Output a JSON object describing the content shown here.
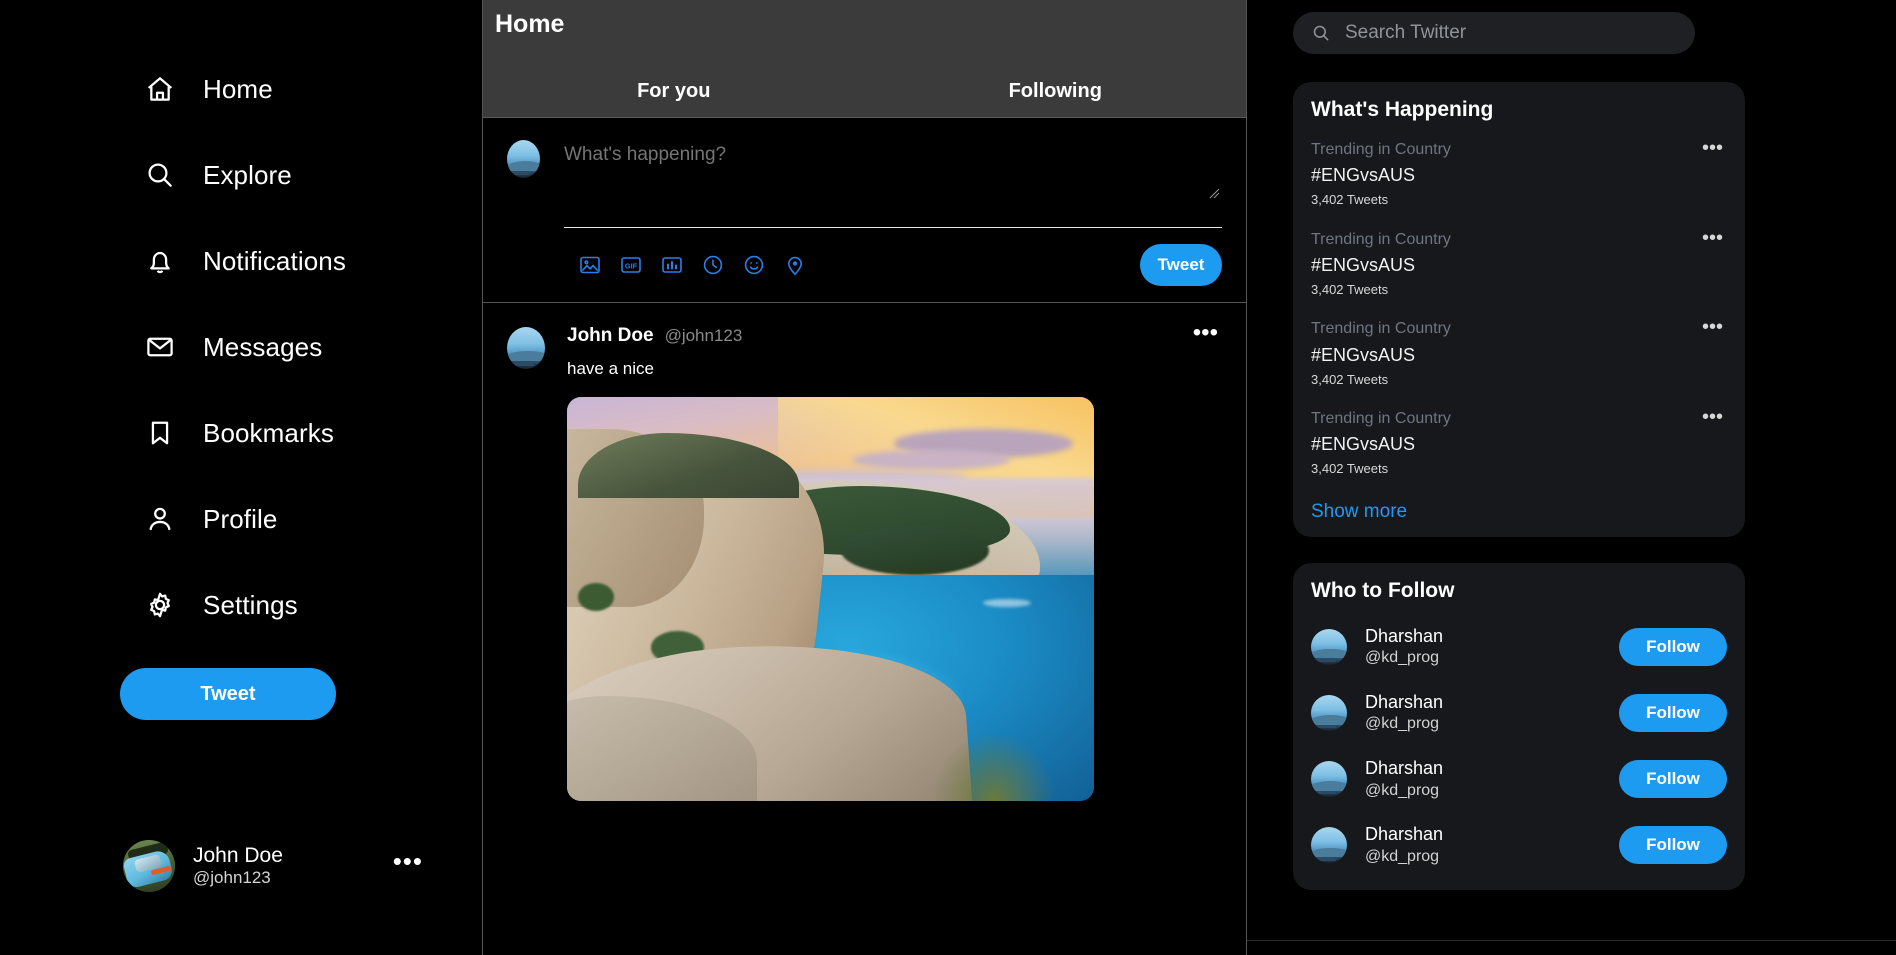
{
  "sidebar": {
    "items": [
      {
        "label": "Home",
        "icon": "home-icon"
      },
      {
        "label": "Explore",
        "icon": "search-icon"
      },
      {
        "label": "Notifications",
        "icon": "bell-icon"
      },
      {
        "label": "Messages",
        "icon": "envelope-icon"
      },
      {
        "label": "Bookmarks",
        "icon": "bookmark-icon"
      },
      {
        "label": "Profile",
        "icon": "person-icon"
      },
      {
        "label": "Settings",
        "icon": "gear-icon"
      }
    ],
    "tweet_button": "Tweet",
    "account": {
      "name": "John Doe",
      "handle": "@john123",
      "more": "•••"
    }
  },
  "main": {
    "title": "Home",
    "tabs": [
      {
        "label": "For you",
        "active": true
      },
      {
        "label": "Following",
        "active": false
      }
    ],
    "compose": {
      "placeholder": "What's happening?",
      "value": "",
      "tweet_button": "Tweet",
      "icons": [
        "image-icon",
        "gif-icon",
        "poll-icon",
        "schedule-clock-icon",
        "emoji-icon",
        "location-pin-icon"
      ]
    },
    "tweets": [
      {
        "name": "John Doe",
        "handle": "@john123",
        "text": "have a nice",
        "more": "•••",
        "media_alt": "Coastal cliff bay at sunset"
      }
    ]
  },
  "right": {
    "search": {
      "placeholder": "Search Twitter",
      "value": "",
      "icon": "search-icon"
    },
    "whats_happening": {
      "title": "What's Happening",
      "show_more": "Show more",
      "trends": [
        {
          "category": "Trending in Country",
          "tag": "#ENGvsAUS",
          "count": "3,402 Tweets",
          "more": "•••"
        },
        {
          "category": "Trending in Country",
          "tag": "#ENGvsAUS",
          "count": "3,402 Tweets",
          "more": "•••"
        },
        {
          "category": "Trending in Country",
          "tag": "#ENGvsAUS",
          "count": "3,402 Tweets",
          "more": "•••"
        },
        {
          "category": "Trending in Country",
          "tag": "#ENGvsAUS",
          "count": "3,402 Tweets",
          "more": "•••"
        }
      ]
    },
    "who_to_follow": {
      "title": "Who to Follow",
      "people": [
        {
          "name": "Dharshan",
          "handle": "@kd_prog",
          "button": "Follow"
        },
        {
          "name": "Dharshan",
          "handle": "@kd_prog",
          "button": "Follow"
        },
        {
          "name": "Dharshan",
          "handle": "@kd_prog",
          "button": "Follow"
        },
        {
          "name": "Dharshan",
          "handle": "@kd_prog",
          "button": "Follow"
        }
      ]
    }
  },
  "colors": {
    "accent": "#1d9bf0",
    "compose_icon": "#2b7fe8",
    "background": "#000000",
    "header_bg": "#3b3b3b",
    "card_bg": "#16181c",
    "search_bg": "#1e2023",
    "muted_text": "#6f7681"
  }
}
